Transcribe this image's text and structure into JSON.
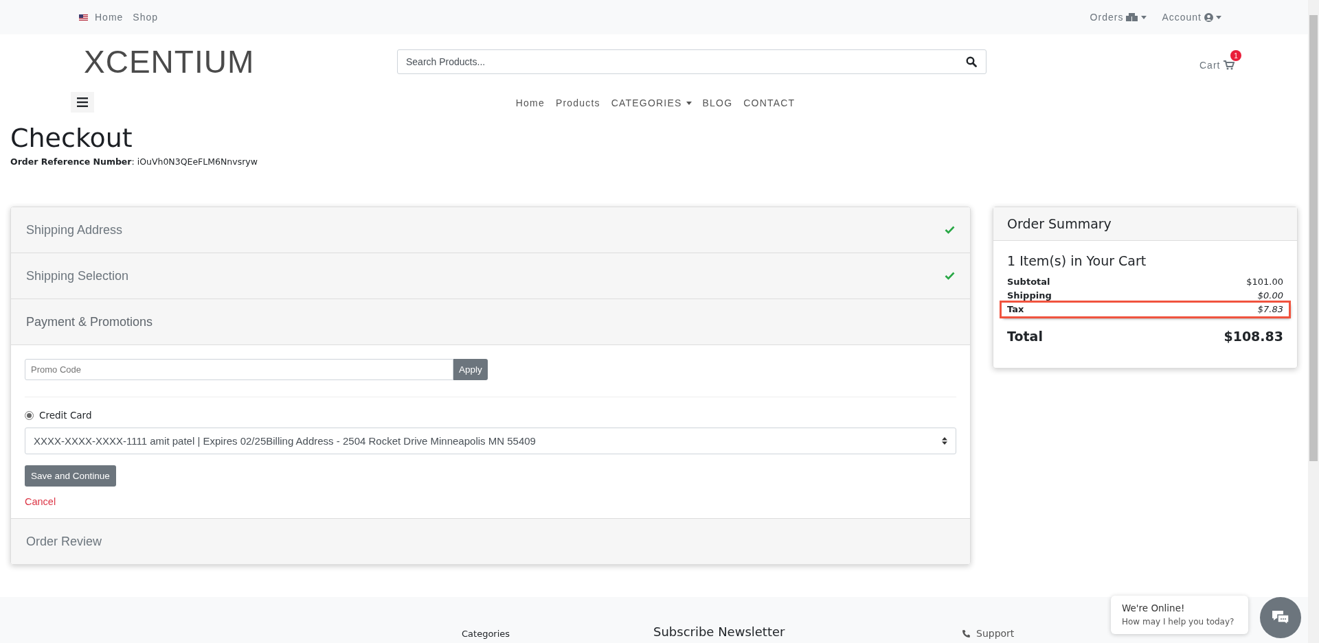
{
  "top_bar": {
    "left_links": [
      {
        "label": "Home",
        "flag": true
      },
      {
        "label": "Shop",
        "flag": false
      }
    ],
    "right_links": [
      {
        "label": "Orders"
      },
      {
        "label": "Account"
      }
    ]
  },
  "header": {
    "logo": "XCENTIUM",
    "search": {
      "placeholder": "Search Products..."
    },
    "cart": {
      "label": "Cart",
      "count": "1"
    }
  },
  "nav": [
    {
      "label": "Home",
      "dropdown": false
    },
    {
      "label": "Products",
      "dropdown": false
    },
    {
      "label": "CATEGORIES",
      "dropdown": true
    },
    {
      "label": "BLOG",
      "dropdown": false
    },
    {
      "label": "CONTACT",
      "dropdown": false
    }
  ],
  "page": {
    "title": "Checkout",
    "reference": "**Order Reference Number**: iOuVh0N3QEeFLM6Nnvsryw"
  },
  "sections": [
    {
      "title": "Shipping Address",
      "done": true,
      "expanded": false
    },
    {
      "title": "Shipping Selection",
      "done": true,
      "expanded": false
    },
    {
      "title": "Payment & Promotions",
      "done": false,
      "expanded": true
    },
    {
      "title": "Order Review",
      "done": false,
      "expanded": false
    }
  ],
  "payment": {
    "promo_placeholder": "Promo Code",
    "apply": "Apply",
    "method": {
      "label": "Credit Card",
      "selected": true
    },
    "card_select": "XXXX-XXXX-XXXX-1111 amit patel | Expires 02/25Billing Address - 2504 Rocket Drive Minneapolis MN 55409",
    "save": "Save and Continue",
    "cancel": "Cancel"
  },
  "summary": {
    "title": "Order Summary",
    "items": "1 Item(s) in Your Cart",
    "rows": [
      {
        "label": "Subtotal",
        "value": "$101.00",
        "italic": false,
        "highlighted": false
      },
      {
        "label": "Shipping",
        "value": "$0.00",
        "italic": true,
        "highlighted": false
      },
      {
        "label": "Tax",
        "value": "$7.83",
        "italic": true,
        "highlighted": true
      }
    ],
    "total_label": "Total",
    "total": "$108.83"
  },
  "footer": {
    "headings": [
      "Categories",
      "Subscribe Newsletter"
    ],
    "support": "Support"
  },
  "chat": {
    "title": "We're Online!",
    "subtitle": "How may I help you today?"
  }
}
